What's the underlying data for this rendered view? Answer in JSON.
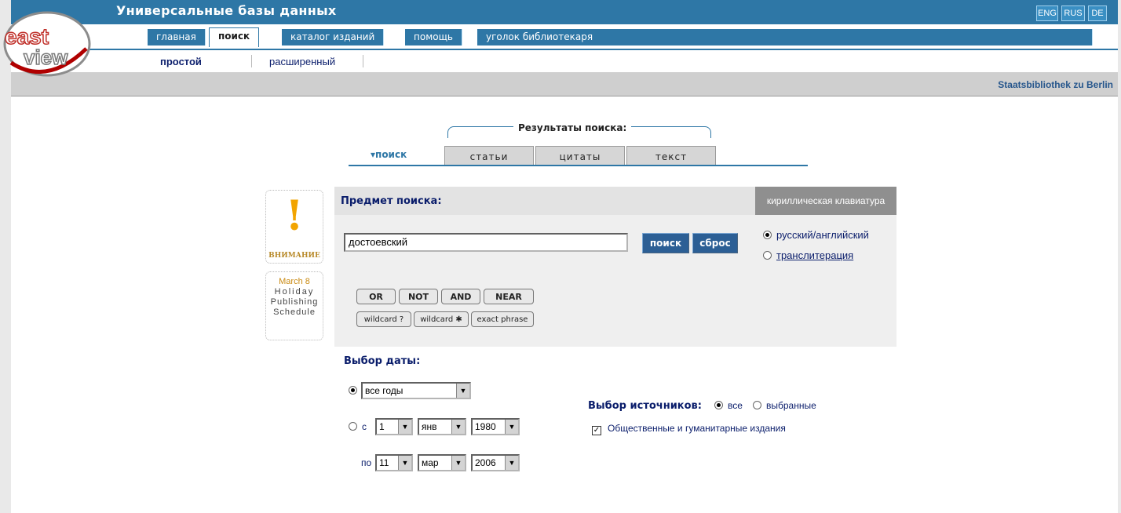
{
  "header": {
    "app_title": "Универсальные базы данных",
    "languages": [
      "ENG",
      "RUS",
      "DE"
    ],
    "library": "Staatsbibliothek zu Berlin",
    "logo_text": [
      "east",
      "view"
    ]
  },
  "nav": {
    "tabs": [
      "главная",
      "поиск",
      "каталог изданий",
      "помощь",
      "уголок библиотекаря"
    ],
    "active": "поиск"
  },
  "subnav": {
    "items": [
      "простой",
      "расширенный"
    ],
    "active": "простой"
  },
  "results": {
    "label": "Результаты поиска:",
    "search_tab": "▾поиск",
    "tabs": [
      "статьи",
      "цитаты",
      "текст"
    ]
  },
  "notices": {
    "warning_symbol": "!",
    "warning_text": "ВНИМАНИЕ",
    "holiday": [
      "March 8",
      "Holiday",
      "Publishing",
      "Schedule"
    ]
  },
  "search": {
    "subject_label": "Предмет поиска:",
    "keyboard_link": "кириллическая клавиатура",
    "query": "достоевский",
    "search_button": "поиск",
    "reset_button": "сброс",
    "mode_options": [
      "русский/английский",
      "транслитерация"
    ],
    "mode_selected": "русский/английский",
    "operators": [
      "OR",
      "NOT",
      "AND",
      "NEAR"
    ],
    "wildcards": [
      "wildcard ?",
      "wildcard ✱",
      "exact phrase"
    ]
  },
  "date": {
    "title": "Выбор даты:",
    "all_years": "все годы",
    "from_label": "с",
    "from": {
      "day": "1",
      "month": "янв",
      "year": "1980"
    },
    "to_label": "по",
    "to": {
      "day": "11",
      "month": "мар",
      "year": "2006"
    },
    "selected": "все годы"
  },
  "sources": {
    "title": "Выбор источников:",
    "options": [
      "все",
      "выбранные"
    ],
    "selected": "все",
    "checkbox_label": "Общественные и гуманитарные издания",
    "checkbox_checked": true
  },
  "colors": {
    "brand_blue": "#2e77a6",
    "dark_blue": "#0a1d6b",
    "button_blue": "#2c5f95",
    "warning": "#f2a400"
  }
}
